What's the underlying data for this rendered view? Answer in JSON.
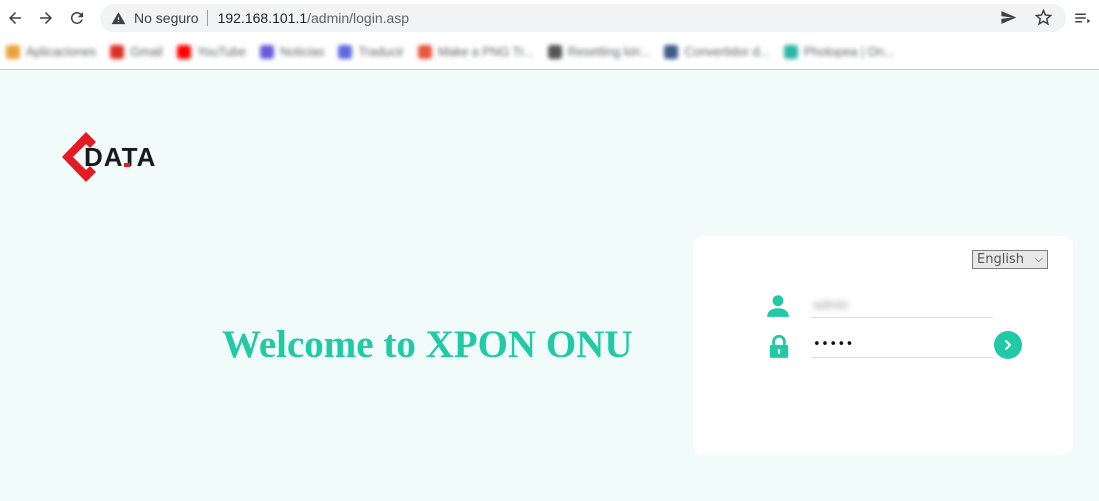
{
  "browser": {
    "security_label": "No seguro",
    "url_host": "192.168.101.1",
    "url_path": "/admin/login.asp",
    "bookmarks": [
      "Aplicaciones",
      "Gmail",
      "YouTube",
      "Noticias",
      "Traducir",
      "Make a PNG Tr...",
      "Resetting kiri...",
      "Convertidor d...",
      "Photopea | On..."
    ],
    "bookmark_colors": [
      "#e8a23c",
      "#d93025",
      "#ff0000",
      "#6b5bd6",
      "#5f6ae0",
      "#e8553a",
      "#555555",
      "#3e5a8a",
      "#2bb5a0"
    ]
  },
  "page": {
    "logo_text": "DATA",
    "welcome": "Welcome to XPON ONU",
    "accent_color": "#21c9a6",
    "brand_red": "#e31b23"
  },
  "login": {
    "language": "English",
    "username_value": "admin",
    "password_mask": "•••••",
    "submit_icon": "chevron-right-icon"
  }
}
